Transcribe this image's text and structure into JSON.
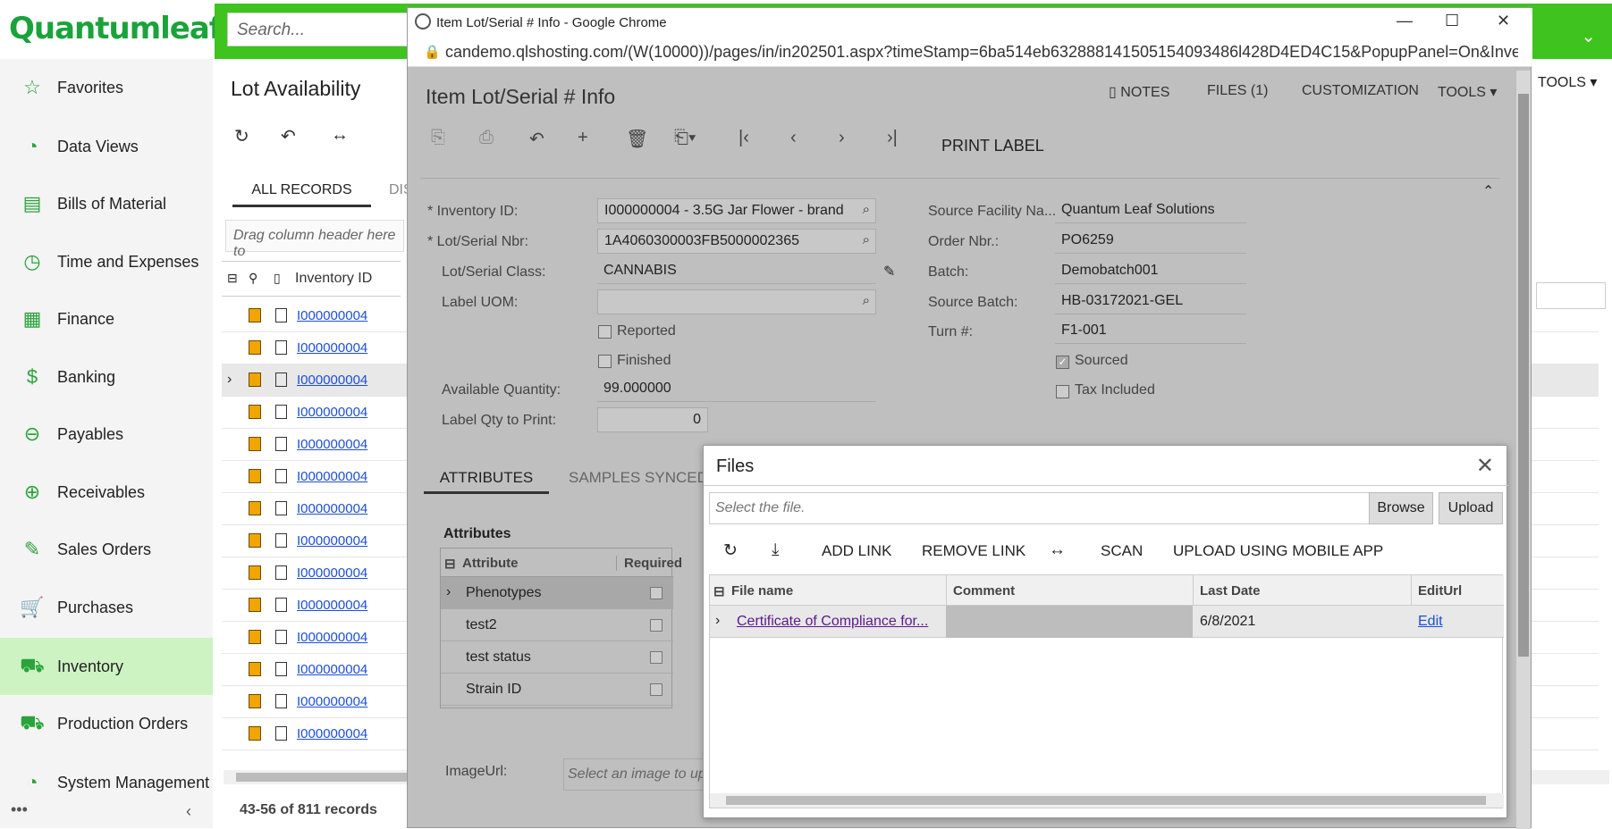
{
  "brand": {
    "logo": "Quantumleaf"
  },
  "topbar": {
    "search_placeholder": "Search..."
  },
  "sidebar": {
    "items": [
      {
        "label": "Favorites",
        "icon": "star-icon"
      },
      {
        "label": "Data Views",
        "icon": "pie-chart-icon"
      },
      {
        "label": "Bills of Material",
        "icon": "receipt-icon"
      },
      {
        "label": "Time and Expenses",
        "icon": "stopwatch-icon"
      },
      {
        "label": "Finance",
        "icon": "calculator-icon"
      },
      {
        "label": "Banking",
        "icon": "dollar-icon"
      },
      {
        "label": "Payables",
        "icon": "minus-circle-icon"
      },
      {
        "label": "Receivables",
        "icon": "plus-circle-icon"
      },
      {
        "label": "Sales Orders",
        "icon": "pencil-icon"
      },
      {
        "label": "Purchases",
        "icon": "cart-icon"
      },
      {
        "label": "Inventory",
        "icon": "truck-icon"
      },
      {
        "label": "Production Orders",
        "icon": "truck-icon"
      },
      {
        "label": "System Management",
        "icon": "pie-chart-icon"
      }
    ],
    "active": "Inventory",
    "more": "•••",
    "collapse": "‹"
  },
  "main": {
    "title": "Lot Availability",
    "tabs": [
      "ALL RECORDS",
      "DIS"
    ],
    "drag_hint": "Drag column header here to",
    "column_inventory": "Inventory ID",
    "rows": [
      "I000000004",
      "I000000004",
      "I000000004",
      "I000000004",
      "I000000004",
      "I000000004",
      "I000000004",
      "I000000004",
      "I000000004",
      "I000000004",
      "I000000004",
      "I000000004",
      "I000000004",
      "I000000004"
    ],
    "record_count": "43-56 of 811 records",
    "tools": "TOOLS"
  },
  "chrome": {
    "window_title": "Item Lot/Serial # Info - Google Chrome",
    "url": "candemo.qlshosting.com/(W(10000))/pages/in/in202501.aspx?timeStamp=6ba514eb632888141505154093486l428D4ED4C15&PopupPanel=On&Invent..."
  },
  "popup": {
    "title": "Item Lot/Serial # Info",
    "top_actions": {
      "notes": "NOTES",
      "files": "FILES (1)",
      "customization": "CUSTOMIZATION",
      "tools": "TOOLS"
    },
    "print_label": "PRINT LABEL",
    "form": {
      "inventory_id_label": "Inventory ID:",
      "inventory_id": "I000000004 - 3.5G Jar Flower - brand",
      "lot_serial_label": "Lot/Serial Nbr:",
      "lot_serial": "1A4060300003FB5000002365",
      "lot_class_label": "Lot/Serial Class:",
      "lot_class": "CANNABIS",
      "label_uom_label": "Label UOM:",
      "label_uom": "",
      "reported": "Reported",
      "finished": "Finished",
      "avail_qty_label": "Available Quantity:",
      "avail_qty": "99.000000",
      "label_qty_label": "Label Qty to Print:",
      "label_qty": "0",
      "source_facility_label": "Source Facility Na...",
      "source_facility": "Quantum Leaf Solutions",
      "order_nbr_label": "Order Nbr.:",
      "order_nbr": "PO6259",
      "batch_label": "Batch:",
      "batch": "Demobatch001",
      "source_batch_label": "Source Batch:",
      "source_batch": "HB-03172021-GEL",
      "turn_label": "Turn #:",
      "turn": "F1-001",
      "sourced": "Sourced",
      "tax_included": "Tax Included"
    },
    "tabs": {
      "attributes": "ATTRIBUTES",
      "samples": "SAMPLES SYNCED"
    },
    "attributes": {
      "heading": "Attributes",
      "col_attribute": "Attribute",
      "col_required": "Required",
      "rows": [
        "Phenotypes",
        "test2",
        "test status",
        "Strain ID"
      ]
    },
    "image_url_label": "ImageUrl:",
    "image_url_placeholder": "Select an image to upload"
  },
  "files": {
    "title": "Files",
    "input_placeholder": "Select the file.",
    "browse": "Browse",
    "upload": "Upload",
    "toolbar": {
      "add_link": "ADD LINK",
      "remove_link": "REMOVE LINK",
      "scan": "SCAN",
      "mobile": "UPLOAD USING MOBILE APP"
    },
    "columns": {
      "file_name": "File name",
      "comment": "Comment",
      "last_date": "Last Date",
      "edit_url": "EditUrl"
    },
    "row": {
      "file_name": "Certificate of Compliance for...",
      "comment": "",
      "last_date": "6/8/2021",
      "edit": "Edit"
    }
  }
}
